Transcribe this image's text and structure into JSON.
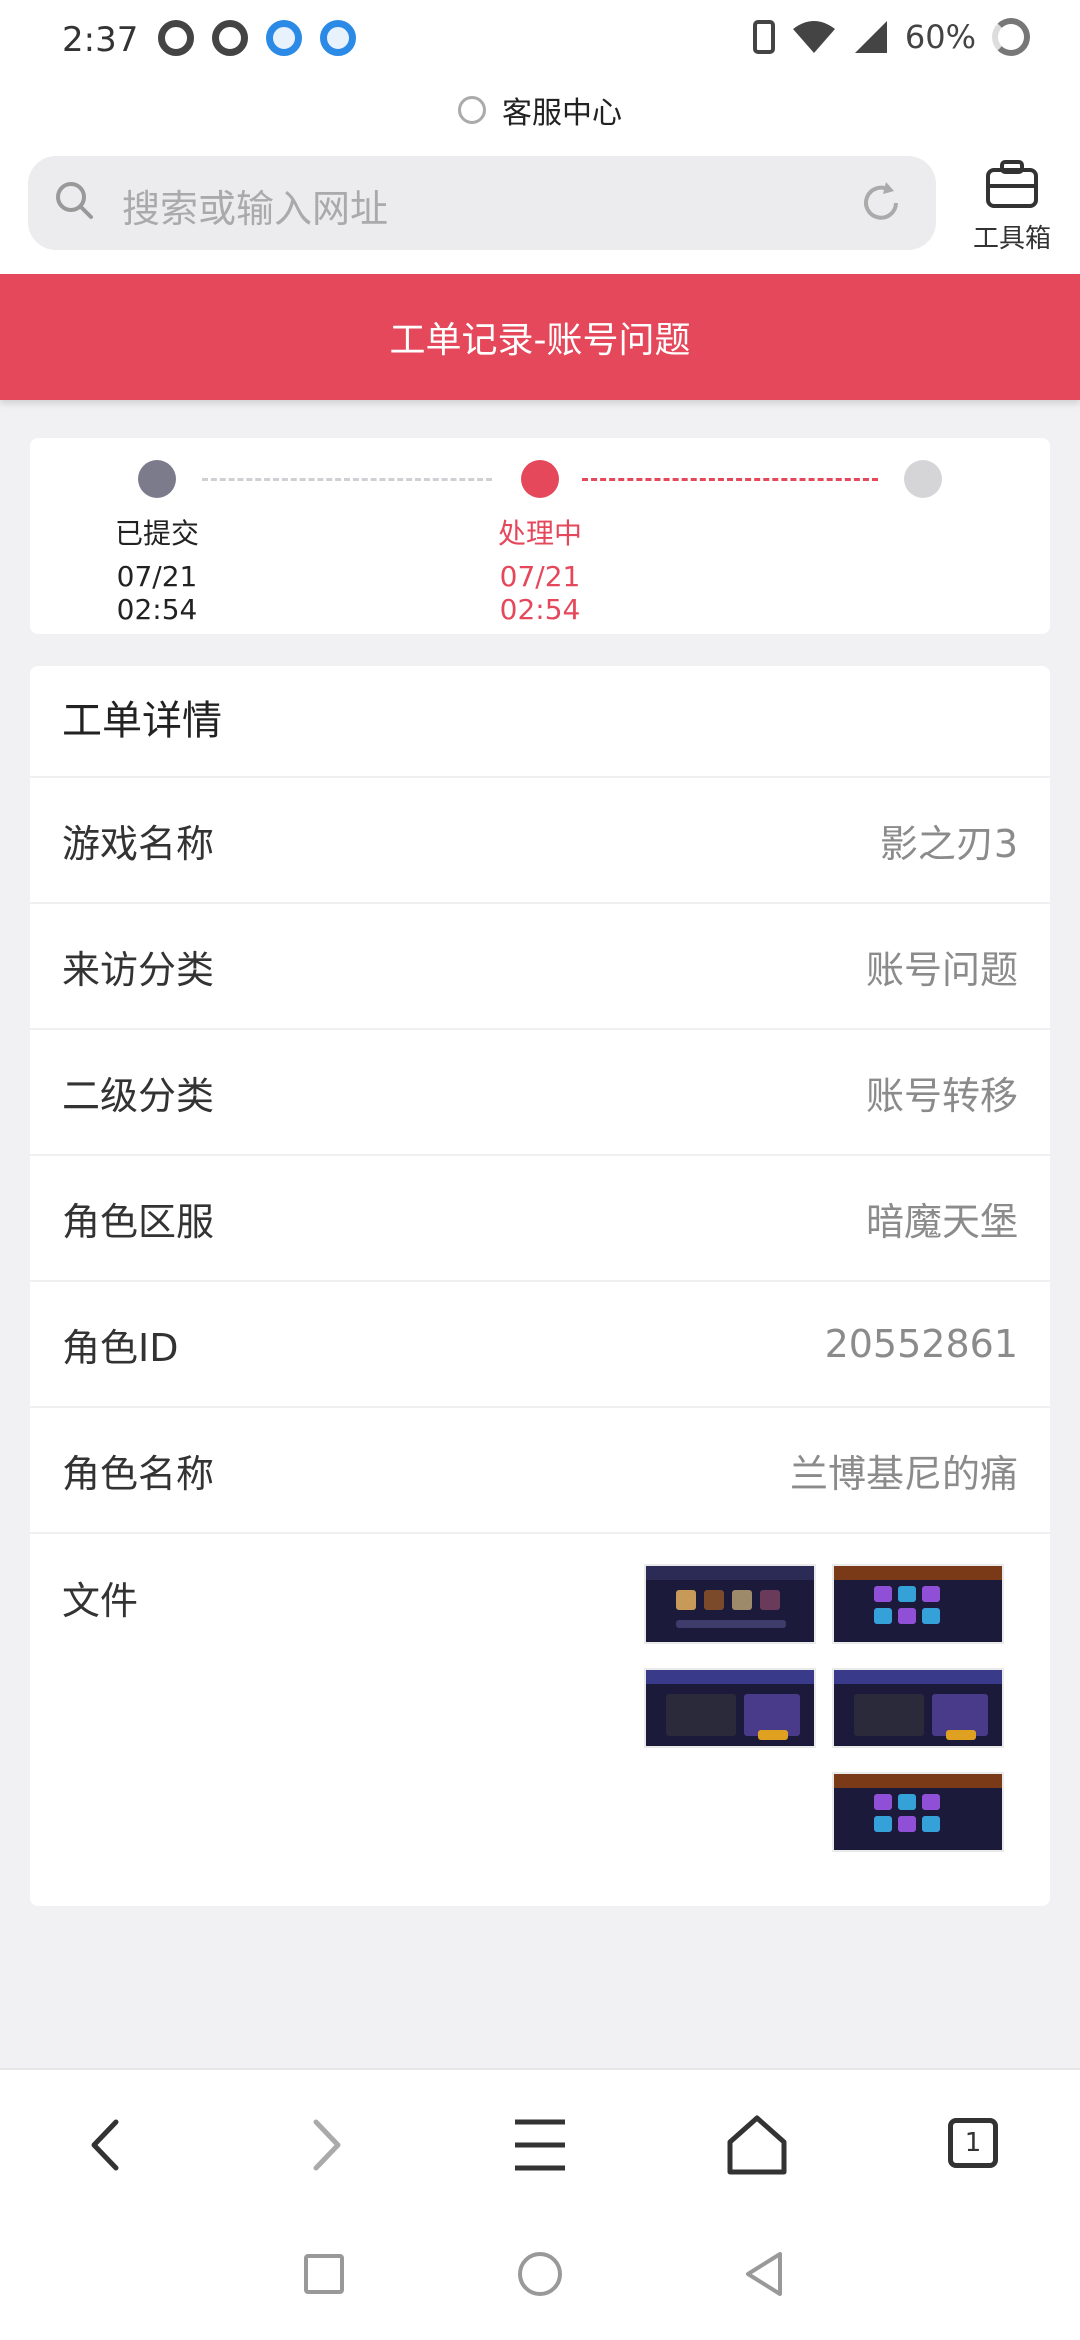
{
  "status_bar": {
    "time": "2:37",
    "battery": "60%",
    "icons": [
      "q-app-icon",
      "q-app-icon",
      "qq-browser-icon",
      "qq-browser-icon",
      "vibrate-icon",
      "wifi-icon",
      "signal-icon",
      "battery-icon"
    ]
  },
  "site": {
    "title": "客服中心"
  },
  "browser": {
    "search_placeholder": "搜索或输入网址",
    "toolbox_label": "工具箱"
  },
  "header": {
    "title": "工单记录-账号问题"
  },
  "progress": {
    "steps": [
      {
        "label": "已提交",
        "time": "07/21 02:54",
        "state": "done"
      },
      {
        "label": "处理中",
        "time": "07/21 02:54",
        "state": "active"
      },
      {
        "label": "",
        "time": "",
        "state": "pending"
      }
    ],
    "colors": {
      "done": "#7b7b8c",
      "active": "#e5485a",
      "pending": "#d5d5d8"
    }
  },
  "details": {
    "title": "工单详情",
    "rows": [
      {
        "label": "游戏名称",
        "value": "影之刃3"
      },
      {
        "label": "来访分类",
        "value": "账号问题"
      },
      {
        "label": "二级分类",
        "value": "账号转移"
      },
      {
        "label": "角色区服",
        "value": "暗魔天堡"
      },
      {
        "label": "角色ID",
        "value": "20552861"
      },
      {
        "label": "角色名称",
        "value": "兰博基尼的痛"
      }
    ],
    "file_label": "文件",
    "file_count": 5
  },
  "bottom_nav": {
    "tab_count": "1",
    "icons": [
      "back-icon",
      "forward-icon",
      "menu-icon",
      "home-icon",
      "tabs-icon"
    ]
  },
  "system_nav": {
    "icons": [
      "recent-apps-icon",
      "home-circle-icon",
      "back-triangle-icon"
    ]
  },
  "colors": {
    "accent": "#e5485a",
    "background": "#f1f1f3"
  }
}
